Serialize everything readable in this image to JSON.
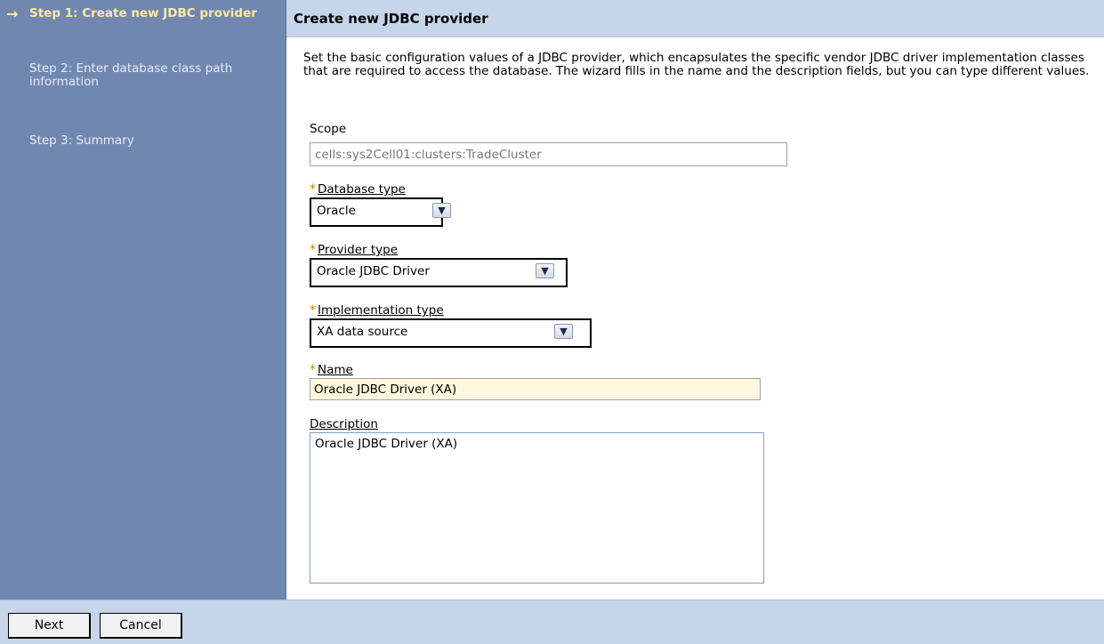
{
  "sidebar": {
    "steps": [
      {
        "label": "Step 1: Create new JDBC provider",
        "current": true
      },
      {
        "label": "Step 2: Enter database class path information",
        "current": false
      },
      {
        "label": "Step 3: Summary",
        "current": false
      }
    ]
  },
  "main": {
    "title": "Create new JDBC provider",
    "intro": "Set the basic configuration values of a JDBC provider, which encapsulates the specific vendor JDBC driver implementation classes that are required to access the database. The wizard fills in the name and the description fields, but you can type different values.",
    "scope": {
      "label": "Scope",
      "value": "cells:sys2Cell01:clusters:TradeCluster"
    },
    "database_type": {
      "label": "Database type",
      "selected": "Oracle",
      "required": true
    },
    "provider_type": {
      "label": "Provider type",
      "selected": "Oracle JDBC Driver",
      "required": true
    },
    "implementation_type": {
      "label": "Implementation type",
      "selected": "XA data source",
      "required": true
    },
    "name": {
      "label": "Name",
      "value": "Oracle JDBC Driver (XA)",
      "required": true
    },
    "description": {
      "label": "Description",
      "value": "Oracle JDBC Driver (XA)"
    }
  },
  "footer": {
    "next_label": "Next",
    "cancel_label": "Cancel"
  },
  "icons": {
    "current_step": "right-arrow-icon",
    "dropdown": "chevron-down-icon",
    "required": "asterisk-icon"
  },
  "colors": {
    "sidebar_bg": "#7088b0",
    "header_bg": "#c7d5ea",
    "current_step": "#fde9a2",
    "required_marker": "#c08a00"
  }
}
